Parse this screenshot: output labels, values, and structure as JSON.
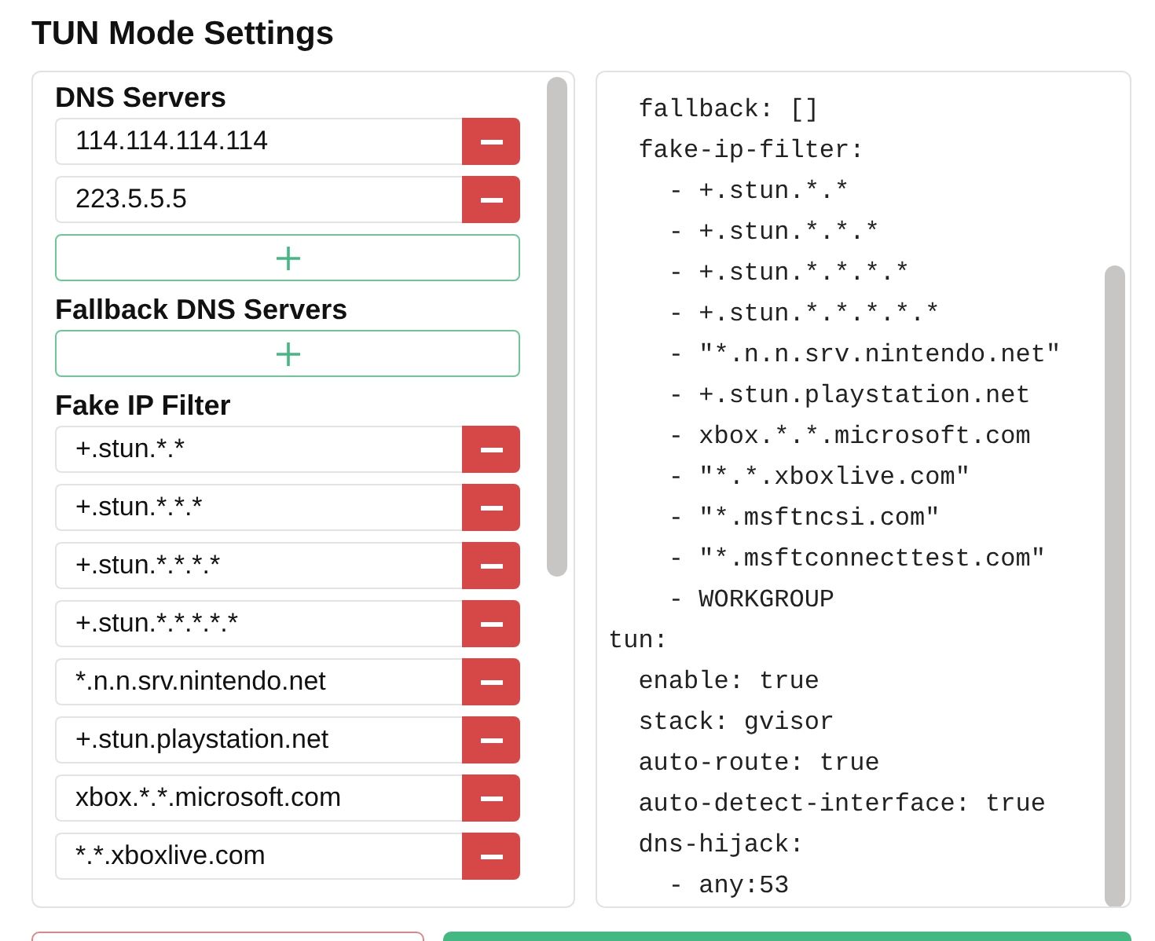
{
  "title": "TUN Mode Settings",
  "sections": [
    {
      "heading": "DNS Servers",
      "add_button": true,
      "items": [
        "114.114.114.114",
        "223.5.5.5"
      ]
    },
    {
      "heading": "Fallback DNS Servers",
      "add_button": true
    },
    {
      "heading": "Fake IP Filter",
      "add_button": false,
      "items": [
        "+.stun.*.*",
        "+.stun.*.*.*",
        "+.stun.*.*.*.*",
        "+.stun.*.*.*.*.*",
        "*.n.n.srv.nintendo.net",
        "+.stun.playstation.net",
        "xbox.*.*.microsoft.com",
        "*.*.xboxlive.com"
      ]
    }
  ],
  "yaml_lines": [
    "  fallback: []",
    "  fake-ip-filter:",
    "    - +.stun.*.*",
    "    - +.stun.*.*.*",
    "    - +.stun.*.*.*.*",
    "    - +.stun.*.*.*.*.*",
    "    - \"*.n.n.srv.nintendo.net\"",
    "    - +.stun.playstation.net",
    "    - xbox.*.*.microsoft.com",
    "    - \"*.*.xboxlive.com\"",
    "    - \"*.msftncsi.com\"",
    "    - \"*.msftconnecttest.com\"",
    "    - WORKGROUP",
    "tun:",
    "  enable: true",
    "  stack: gvisor",
    "  auto-route: true",
    "  auto-detect-interface: true",
    "  dns-hijack:",
    "    - any:53"
  ]
}
